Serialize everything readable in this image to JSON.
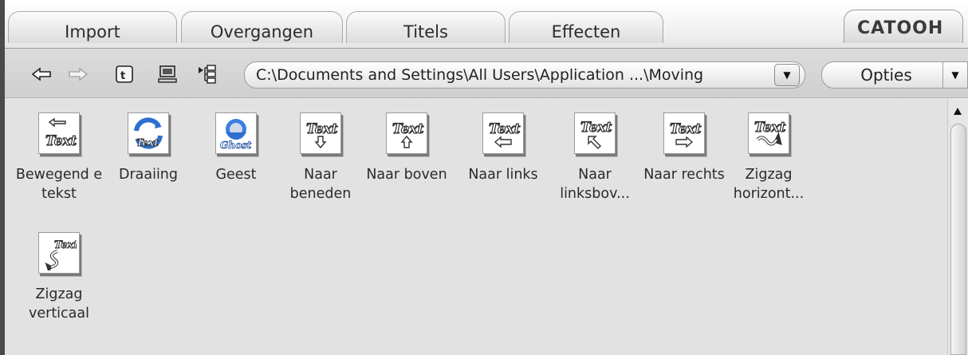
{
  "tabs": [
    {
      "label": "Import"
    },
    {
      "label": "Overgangen"
    },
    {
      "label": "Titels"
    },
    {
      "label": "Effecten"
    }
  ],
  "logo": {
    "text": "CATOOH"
  },
  "toolbar": {
    "path": "C:\\Documents and Settings\\All Users\\Application ...\\Moving",
    "options_label": "Opties",
    "icons": [
      "back-arrow-icon",
      "forward-arrow-icon",
      "up-folder-icon",
      "computer-icon",
      "folder-tree-icon"
    ]
  },
  "items": [
    {
      "label": "Bewegend e tekst",
      "icon": "moving-text-icon"
    },
    {
      "label": "Draaiing",
      "icon": "rotate-text-icon"
    },
    {
      "label": "Geest",
      "icon": "ghost-text-icon"
    },
    {
      "label": "Naar beneden",
      "icon": "text-down-icon"
    },
    {
      "label": "Naar boven",
      "icon": "text-up-icon"
    },
    {
      "label": "Naar links",
      "icon": "text-left-icon"
    },
    {
      "label": "Naar linksbov...",
      "icon": "text-upleft-icon"
    },
    {
      "label": "Naar rechts",
      "icon": "text-right-icon"
    },
    {
      "label": "Zigzag horizont...",
      "icon": "zigzag-horizontal-icon"
    },
    {
      "label": "Zigzag verticaal",
      "icon": "zigzag-vertical-icon"
    }
  ],
  "colors": {
    "accent_blue": "#2f6fd0",
    "background": "#e2e2e2"
  }
}
